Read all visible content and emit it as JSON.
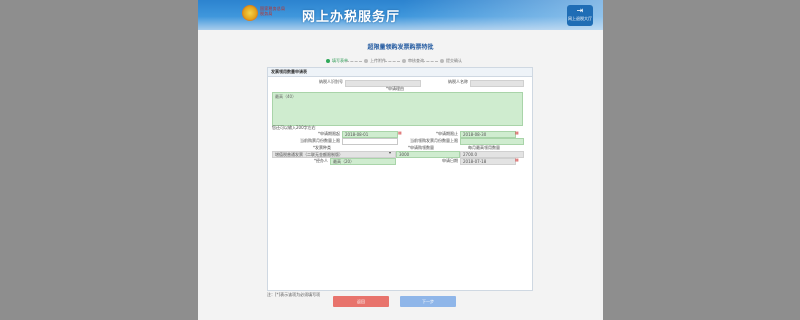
{
  "header": {
    "org_line1": "国家税务总局",
    "org_line2": "税务局",
    "brand": "网上办税服务厅",
    "logout_label": "网上退税大厅"
  },
  "page_title": "超限量领购发票购票特批",
  "steps": [
    {
      "label": "填写表单",
      "active": true
    },
    {
      "label": "上传附件",
      "active": false
    },
    {
      "label": "审核查询",
      "active": false
    },
    {
      "label": "提交确认",
      "active": false
    }
  ],
  "form": {
    "section_title": "发票领用数量申请表",
    "taxpayer_id_label": "纳税人识别号",
    "taxpayer_id_value": "",
    "taxpayer_name_label": "纳税人名称",
    "taxpayer_name_value": "",
    "reason_label": "*申请理由",
    "reason_placeholder": "最高（40）",
    "char_hint": "您还可以输入200字左右",
    "apply_start_label": "*申请期限起",
    "apply_start_value": "2018-08-01",
    "apply_end_label": "*申请期限止",
    "apply_end_value": "2018-08-30",
    "current_limit_label": "当前购票月份数量上限",
    "new_limit_label": "当前领购发票月份数量上限",
    "invoice_type_label": "*发票种类",
    "apply_qty_label": "*申请购领数量",
    "max_qty_label": "每月最高领用数量",
    "invoice_type_value": "增值税普通发票（二联无金额限制版）",
    "apply_qty_value": "3000",
    "max_qty_value": "2700.0",
    "agent_label": "*经办人",
    "agent_placeholder": "最高（20）",
    "apply_date_label": "申请日期",
    "apply_date_value": "2018-07-18"
  },
  "footer_note": "注：[*]表示该项为必须填写项",
  "buttons": {
    "back": "返回",
    "next": "下一步"
  }
}
